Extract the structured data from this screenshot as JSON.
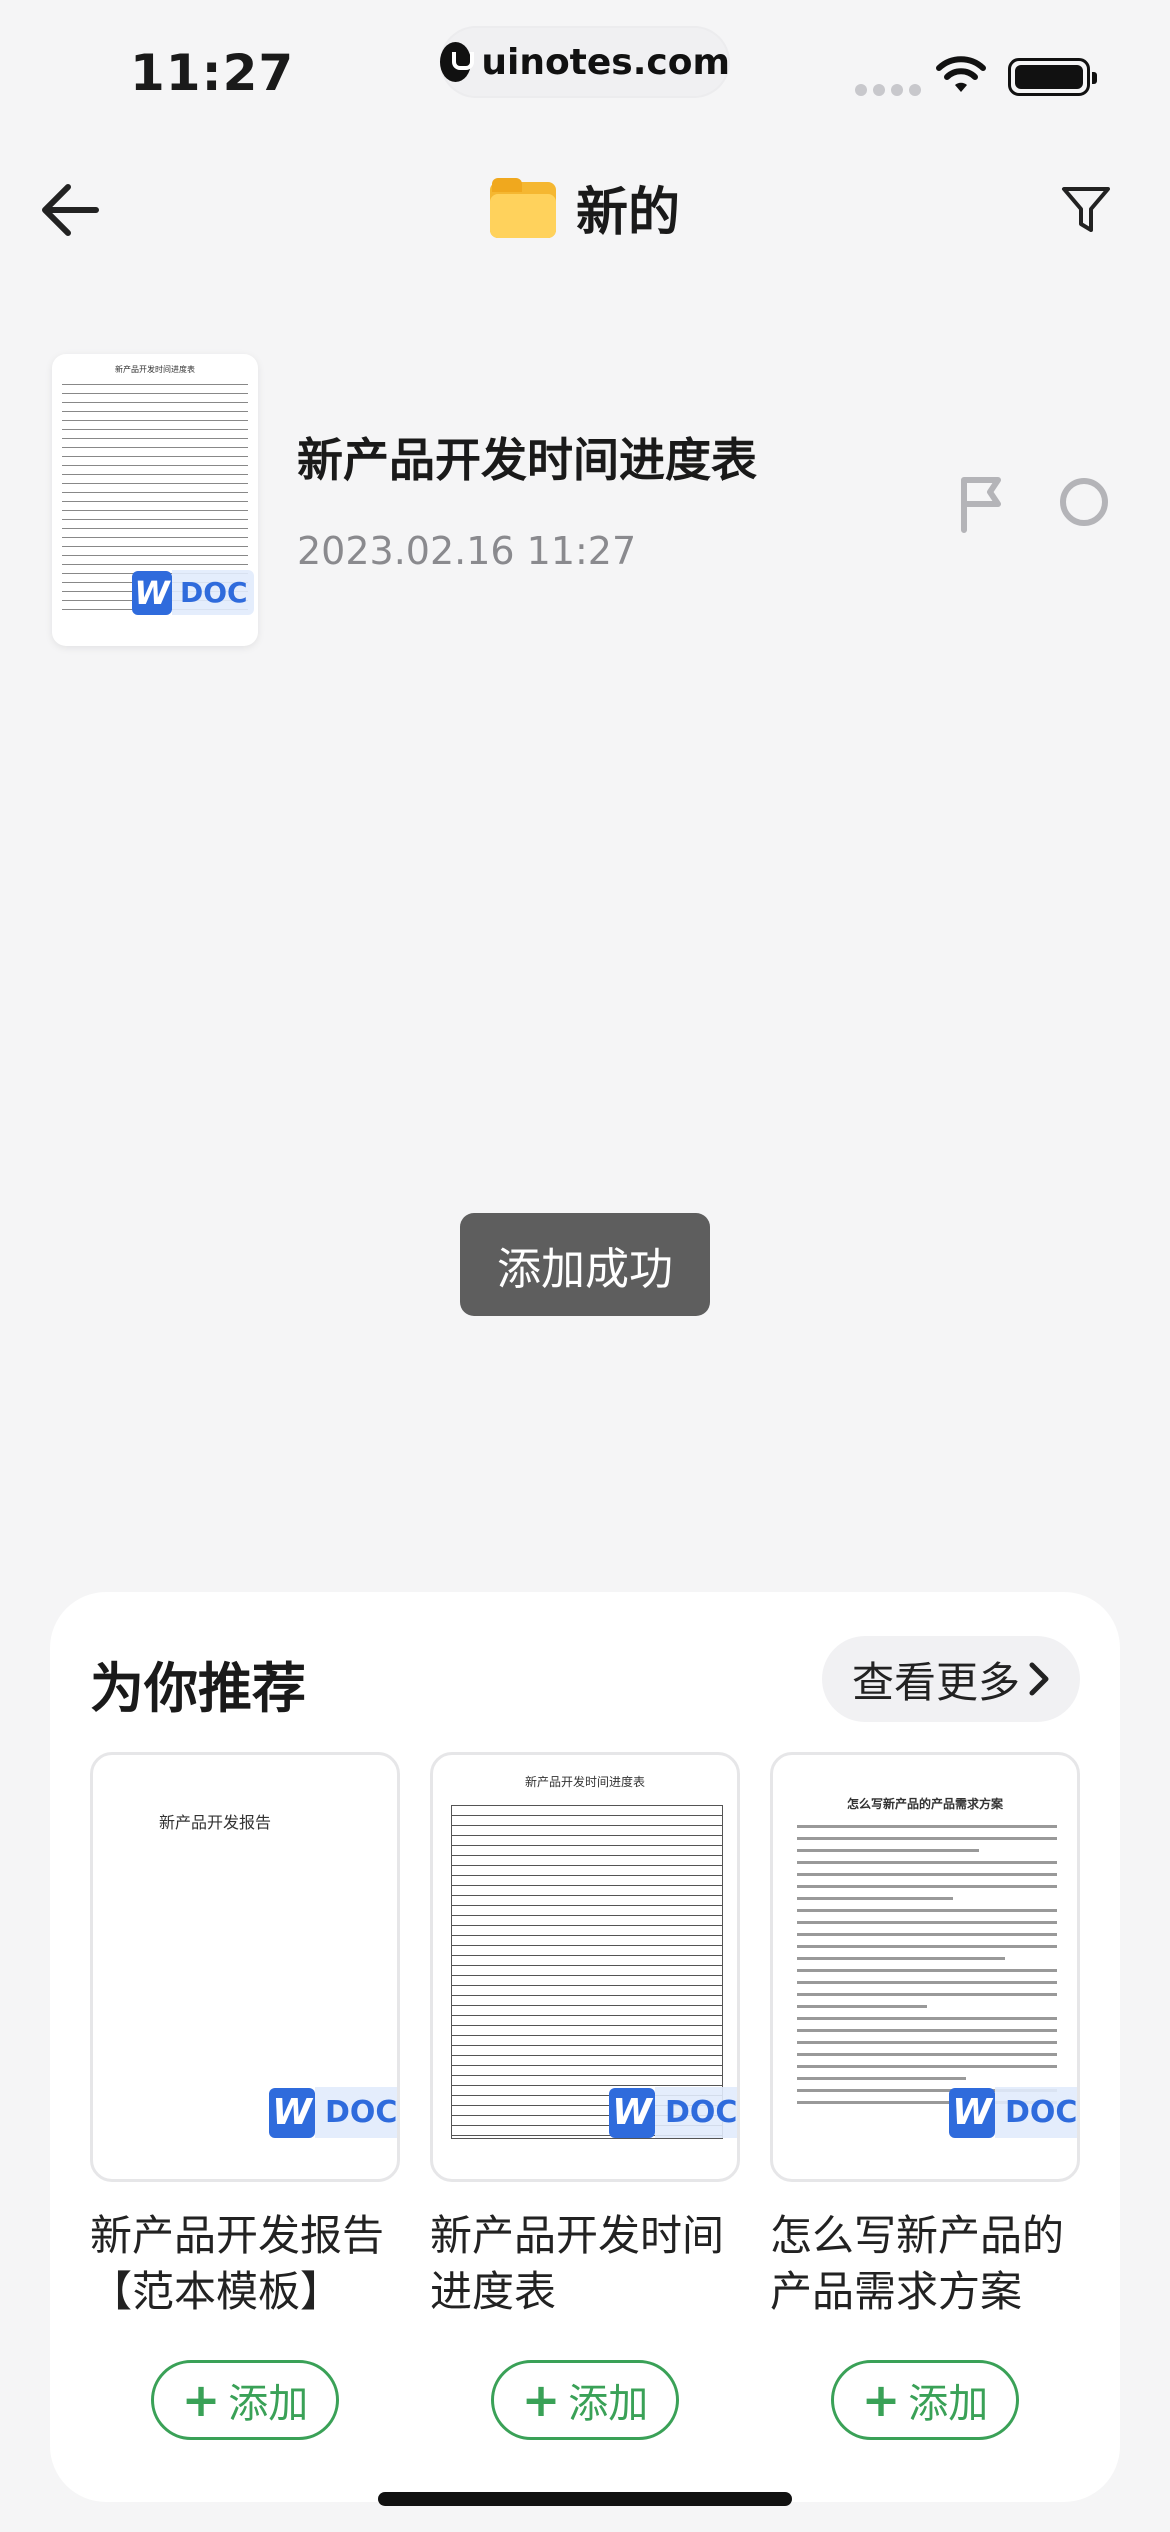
{
  "status": {
    "time": "11:27",
    "url": "uinotes.com"
  },
  "header": {
    "title": "新的",
    "icons": {
      "back": "back-arrow-icon",
      "folder": "folder-icon",
      "filter": "filter-icon"
    }
  },
  "document": {
    "title": "新产品开发时间进度表",
    "date": "2023.02.16 11:27",
    "thumb_title": "新产品开发时间进度表",
    "badge_w": "W",
    "badge_type": "DOC"
  },
  "toast": {
    "text": "添加成功"
  },
  "recommend": {
    "title": "为你推荐",
    "more_label": "查看更多",
    "items": [
      {
        "name": "新产品开发报告【范本模板】",
        "thumb_title": "新产品开发报告",
        "badge_w": "W",
        "badge_type": "DOC",
        "add_label": "添加"
      },
      {
        "name": "新产品开发时间进度表",
        "thumb_title": "新产品开发时间进度表",
        "badge_w": "W",
        "badge_type": "DOC",
        "add_label": "添加"
      },
      {
        "name": "怎么写新产品的产品需求方案",
        "thumb_title": "怎么写新产品的产品需求方案",
        "badge_w": "W",
        "badge_type": "DOC",
        "add_label": "添加"
      }
    ]
  },
  "colors": {
    "accent_green": "#3aa157",
    "doc_blue": "#2f6bdc",
    "background": "#f5f5f6"
  }
}
